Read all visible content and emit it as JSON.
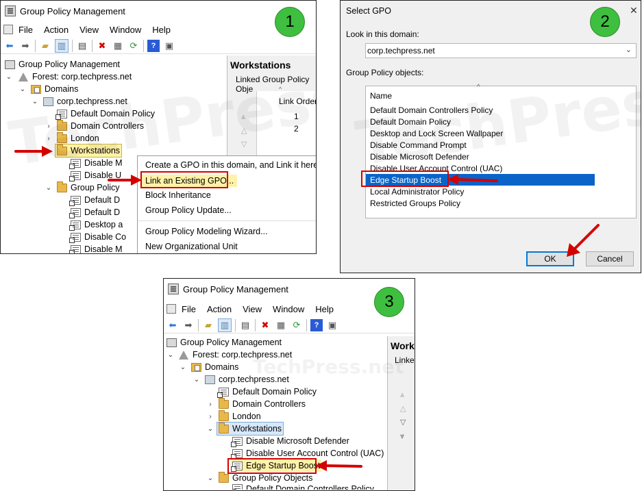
{
  "colors": {
    "accent": "#0078d7",
    "highlight_red": "#d40000",
    "step_green": "#3fbf3f",
    "selection": "#0a64c8"
  },
  "panel1": {
    "step": "1",
    "title": "Group Policy Management",
    "menu": [
      "File",
      "Action",
      "View",
      "Window",
      "Help"
    ],
    "tree": {
      "root": "Group Policy Management",
      "forest": "Forest: corp.techpress.net",
      "domains": "Domains",
      "domain": "corp.techpress.net",
      "default_domain_policy": "Default Domain Policy",
      "domain_controllers": "Domain Controllers",
      "london": "London",
      "workstations": "Workstations",
      "ws_child1": "Disable M",
      "ws_child2": "Disable U",
      "gpo_container": "Group Policy",
      "gpo1": "Default D",
      "gpo2": "Default D",
      "gpo3": "Desktop a",
      "gpo4": "Disable Co",
      "gpo5": "Disable M"
    },
    "right": {
      "header": "Workstations",
      "tab": "Linked Group Policy Obje",
      "col": "Link Order",
      "values": [
        "1",
        "2"
      ]
    },
    "context_menu": [
      "Create a GPO in this domain, and Link it here...",
      "Link an Existing GPO...",
      "Block Inheritance",
      "Group Policy Update...",
      "Group Policy Modeling Wizard...",
      "New Organizational Unit"
    ]
  },
  "panel2": {
    "step": "2",
    "title": "Select GPO",
    "close": "✕",
    "look_label": "Look in this domain:",
    "domain_value": "corp.techpress.net",
    "objects_label": "Group Policy objects:",
    "col_name": "Name",
    "items": [
      "Default Domain Controllers Policy",
      "Default Domain Policy",
      "Desktop and Lock Screen Wallpaper",
      "Disable Command Prompt",
      "Disable Microsoft Defender",
      "Disable User Account Control (UAC)",
      "Edge Startup Boost",
      "Local Administrator Policy",
      "Restricted Groups Policy"
    ],
    "ok": "OK",
    "cancel": "Cancel"
  },
  "panel3": {
    "step": "3",
    "title": "Group Policy Management",
    "menu": [
      "File",
      "Action",
      "View",
      "Window",
      "Help"
    ],
    "tree": {
      "root": "Group Policy Management",
      "forest": "Forest: corp.techpress.net",
      "domains": "Domains",
      "domain": "corp.techpress.net",
      "default_domain_policy": "Default Domain Policy",
      "domain_controllers": "Domain Controllers",
      "london": "London",
      "workstations": "Workstations",
      "ws_child1": "Disable Microsoft Defender",
      "ws_child2": "Disable User Account Control (UAC)",
      "ws_child3": "Edge Startup Boost",
      "gpo_container": "Group Policy Objects",
      "partial": "Default Domain Controllers Policy"
    },
    "right": {
      "header": "Work",
      "tab": "Linke"
    }
  },
  "watermark": "TechPress.net"
}
